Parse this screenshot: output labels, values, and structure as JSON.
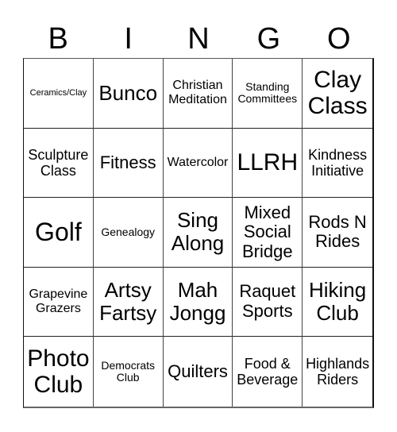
{
  "header": {
    "letters": [
      "B",
      "I",
      "N",
      "G",
      "O"
    ]
  },
  "cells": [
    {
      "text": "Ceramics/Clay",
      "size": "xs"
    },
    {
      "text": "Bunco",
      "size": "xl"
    },
    {
      "text": "Christian\nMeditation",
      "size": "sm"
    },
    {
      "text": "Standing\nCommittees",
      "size": "s"
    },
    {
      "text": "Clay\nClass",
      "size": "xxl"
    },
    {
      "text": "Sculpture\nClass",
      "size": "m"
    },
    {
      "text": "Fitness",
      "size": "l"
    },
    {
      "text": "Watercolor",
      "size": "sm"
    },
    {
      "text": "LLRH",
      "size": "xxl"
    },
    {
      "text": "Kindness\nInitiative",
      "size": "m"
    },
    {
      "text": "Golf",
      "size": "xxxl"
    },
    {
      "text": "Genealogy",
      "size": "s"
    },
    {
      "text": "Sing\nAlong",
      "size": "xl"
    },
    {
      "text": "Mixed\nSocial\nBridge",
      "size": "l"
    },
    {
      "text": "Rods N\nRides",
      "size": "l"
    },
    {
      "text": "Grapevine\nGrazers",
      "size": "sm"
    },
    {
      "text": "Artsy\nFartsy",
      "size": "xl"
    },
    {
      "text": "Mah\nJongg",
      "size": "xl"
    },
    {
      "text": "Raquet\nSports",
      "size": "l"
    },
    {
      "text": "Hiking\nClub",
      "size": "xl"
    },
    {
      "text": "Photo\nClub",
      "size": "xxl"
    },
    {
      "text": "Democrats\nClub",
      "size": "s"
    },
    {
      "text": "Quilters",
      "size": "l"
    },
    {
      "text": "Food &\nBeverage",
      "size": "m"
    },
    {
      "text": "Highlands\nRiders",
      "size": "m"
    }
  ]
}
